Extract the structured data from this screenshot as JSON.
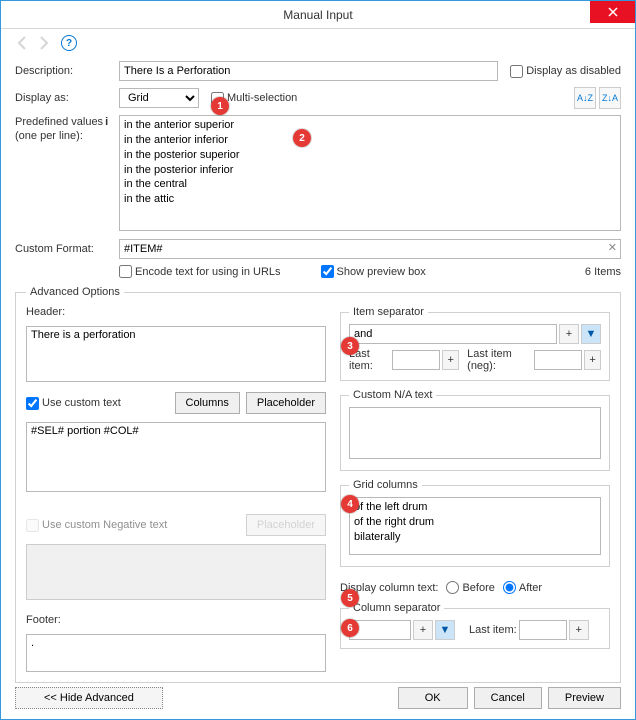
{
  "window": {
    "title": "Manual Input"
  },
  "labels": {
    "description": "Description:",
    "display_as": "Display as:",
    "predefined1": "Predefined values",
    "predefined2": "(one per line):",
    "custom_format": "Custom Format:",
    "encode": "Encode text for using in URLs",
    "show_preview": "Show preview box",
    "items_count": "6 Items",
    "display_disabled": "Display as disabled",
    "multi_selection": "Multi-selection",
    "advanced": "Advanced Options",
    "header": "Header:",
    "use_custom_text": "Use custom text",
    "columns_btn": "Columns",
    "placeholder_btn": "Placeholder",
    "use_neg_text": "Use custom Negative text",
    "footer": "Footer:",
    "item_sep": "Item separator",
    "last_item": "Last item:",
    "last_item_neg": "Last item (neg):",
    "custom_na": "Custom N/A text",
    "grid_cols": "Grid columns",
    "display_col_text": "Display column text:",
    "before": "Before",
    "after": "After",
    "col_sep": "Column separator",
    "hide_adv": "<< Hide Advanced",
    "ok": "OK",
    "cancel": "Cancel",
    "preview": "Preview"
  },
  "values": {
    "description": "There Is a Perforation",
    "display_as": "Grid",
    "predefined": "in the anterior superior\nin the anterior inferior\nin the posterior superior\nin the posterior inferior\nin the central\nin the attic",
    "custom_format": "#ITEM#",
    "header": "There is a perforation",
    "custom_text": "#SEL# portion #COL#",
    "footer": ".",
    "item_sep": "and",
    "grid_cols": "of the left drum\nof the right drum\nbilaterally",
    "col_sep": ","
  },
  "callouts": {
    "c1": "1",
    "c2": "2",
    "c3": "3",
    "c4": "4",
    "c5": "5",
    "c6": "6"
  }
}
